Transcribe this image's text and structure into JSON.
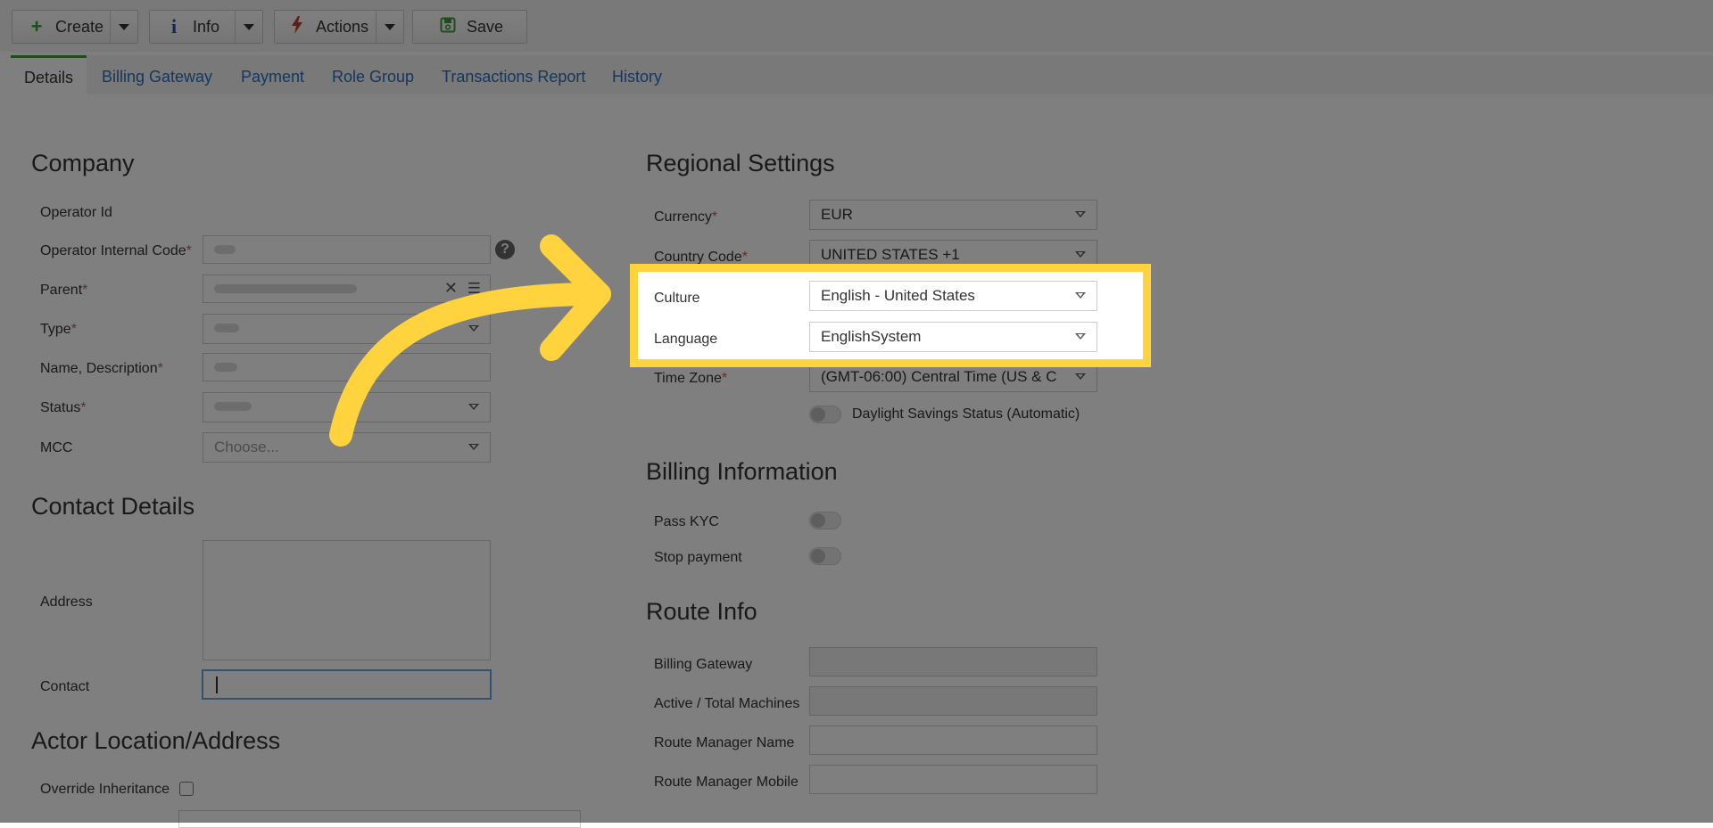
{
  "toolbar": {
    "create_label": "Create",
    "info_label": "Info",
    "actions_label": "Actions",
    "save_label": "Save"
  },
  "tabs": [
    {
      "label": "Details"
    },
    {
      "label": "Billing Gateway"
    },
    {
      "label": "Payment"
    },
    {
      "label": "Role Group"
    },
    {
      "label": "Transactions Report"
    },
    {
      "label": "History"
    }
  ],
  "company": {
    "title": "Company",
    "operator_id_label": "Operator Id",
    "operator_internal_code_label": "Operator Internal Code",
    "parent_label": "Parent",
    "type_label": "Type",
    "name_description_label": "Name, Description",
    "status_label": "Status",
    "mcc_label": "MCC",
    "mcc_placeholder": "Choose..."
  },
  "contact": {
    "title": "Contact Details",
    "address_label": "Address",
    "contact_label": "Contact"
  },
  "location": {
    "title": "Actor Location/Address",
    "override_label": "Override Inheritance"
  },
  "regional": {
    "title": "Regional Settings",
    "currency_label": "Currency",
    "currency_value": "EUR",
    "country_code_label": "Country Code",
    "country_code_value": "UNITED STATES +1",
    "culture_label": "Culture",
    "culture_value": "English - United States",
    "language_label": "Language",
    "language_value": "EnglishSystem",
    "timezone_label": "Time Zone",
    "timezone_value": "(GMT-06:00) Central Time (US & C",
    "dst_label": "Daylight Savings Status (Automatic)"
  },
  "billing": {
    "title": "Billing Information",
    "pass_kyc_label": "Pass KYC",
    "stop_payment_label": "Stop payment"
  },
  "route": {
    "title": "Route Info",
    "billing_gateway_label": "Billing Gateway",
    "machines_label": "Active / Total Machines",
    "manager_name_label": "Route Manager Name",
    "manager_mobile_label": "Route Manager Mobile"
  },
  "colors": {
    "highlight": "#ffd33d",
    "link": "#2a6ebb",
    "required": "#d9534f",
    "active_tab": "#3a9a3a"
  }
}
